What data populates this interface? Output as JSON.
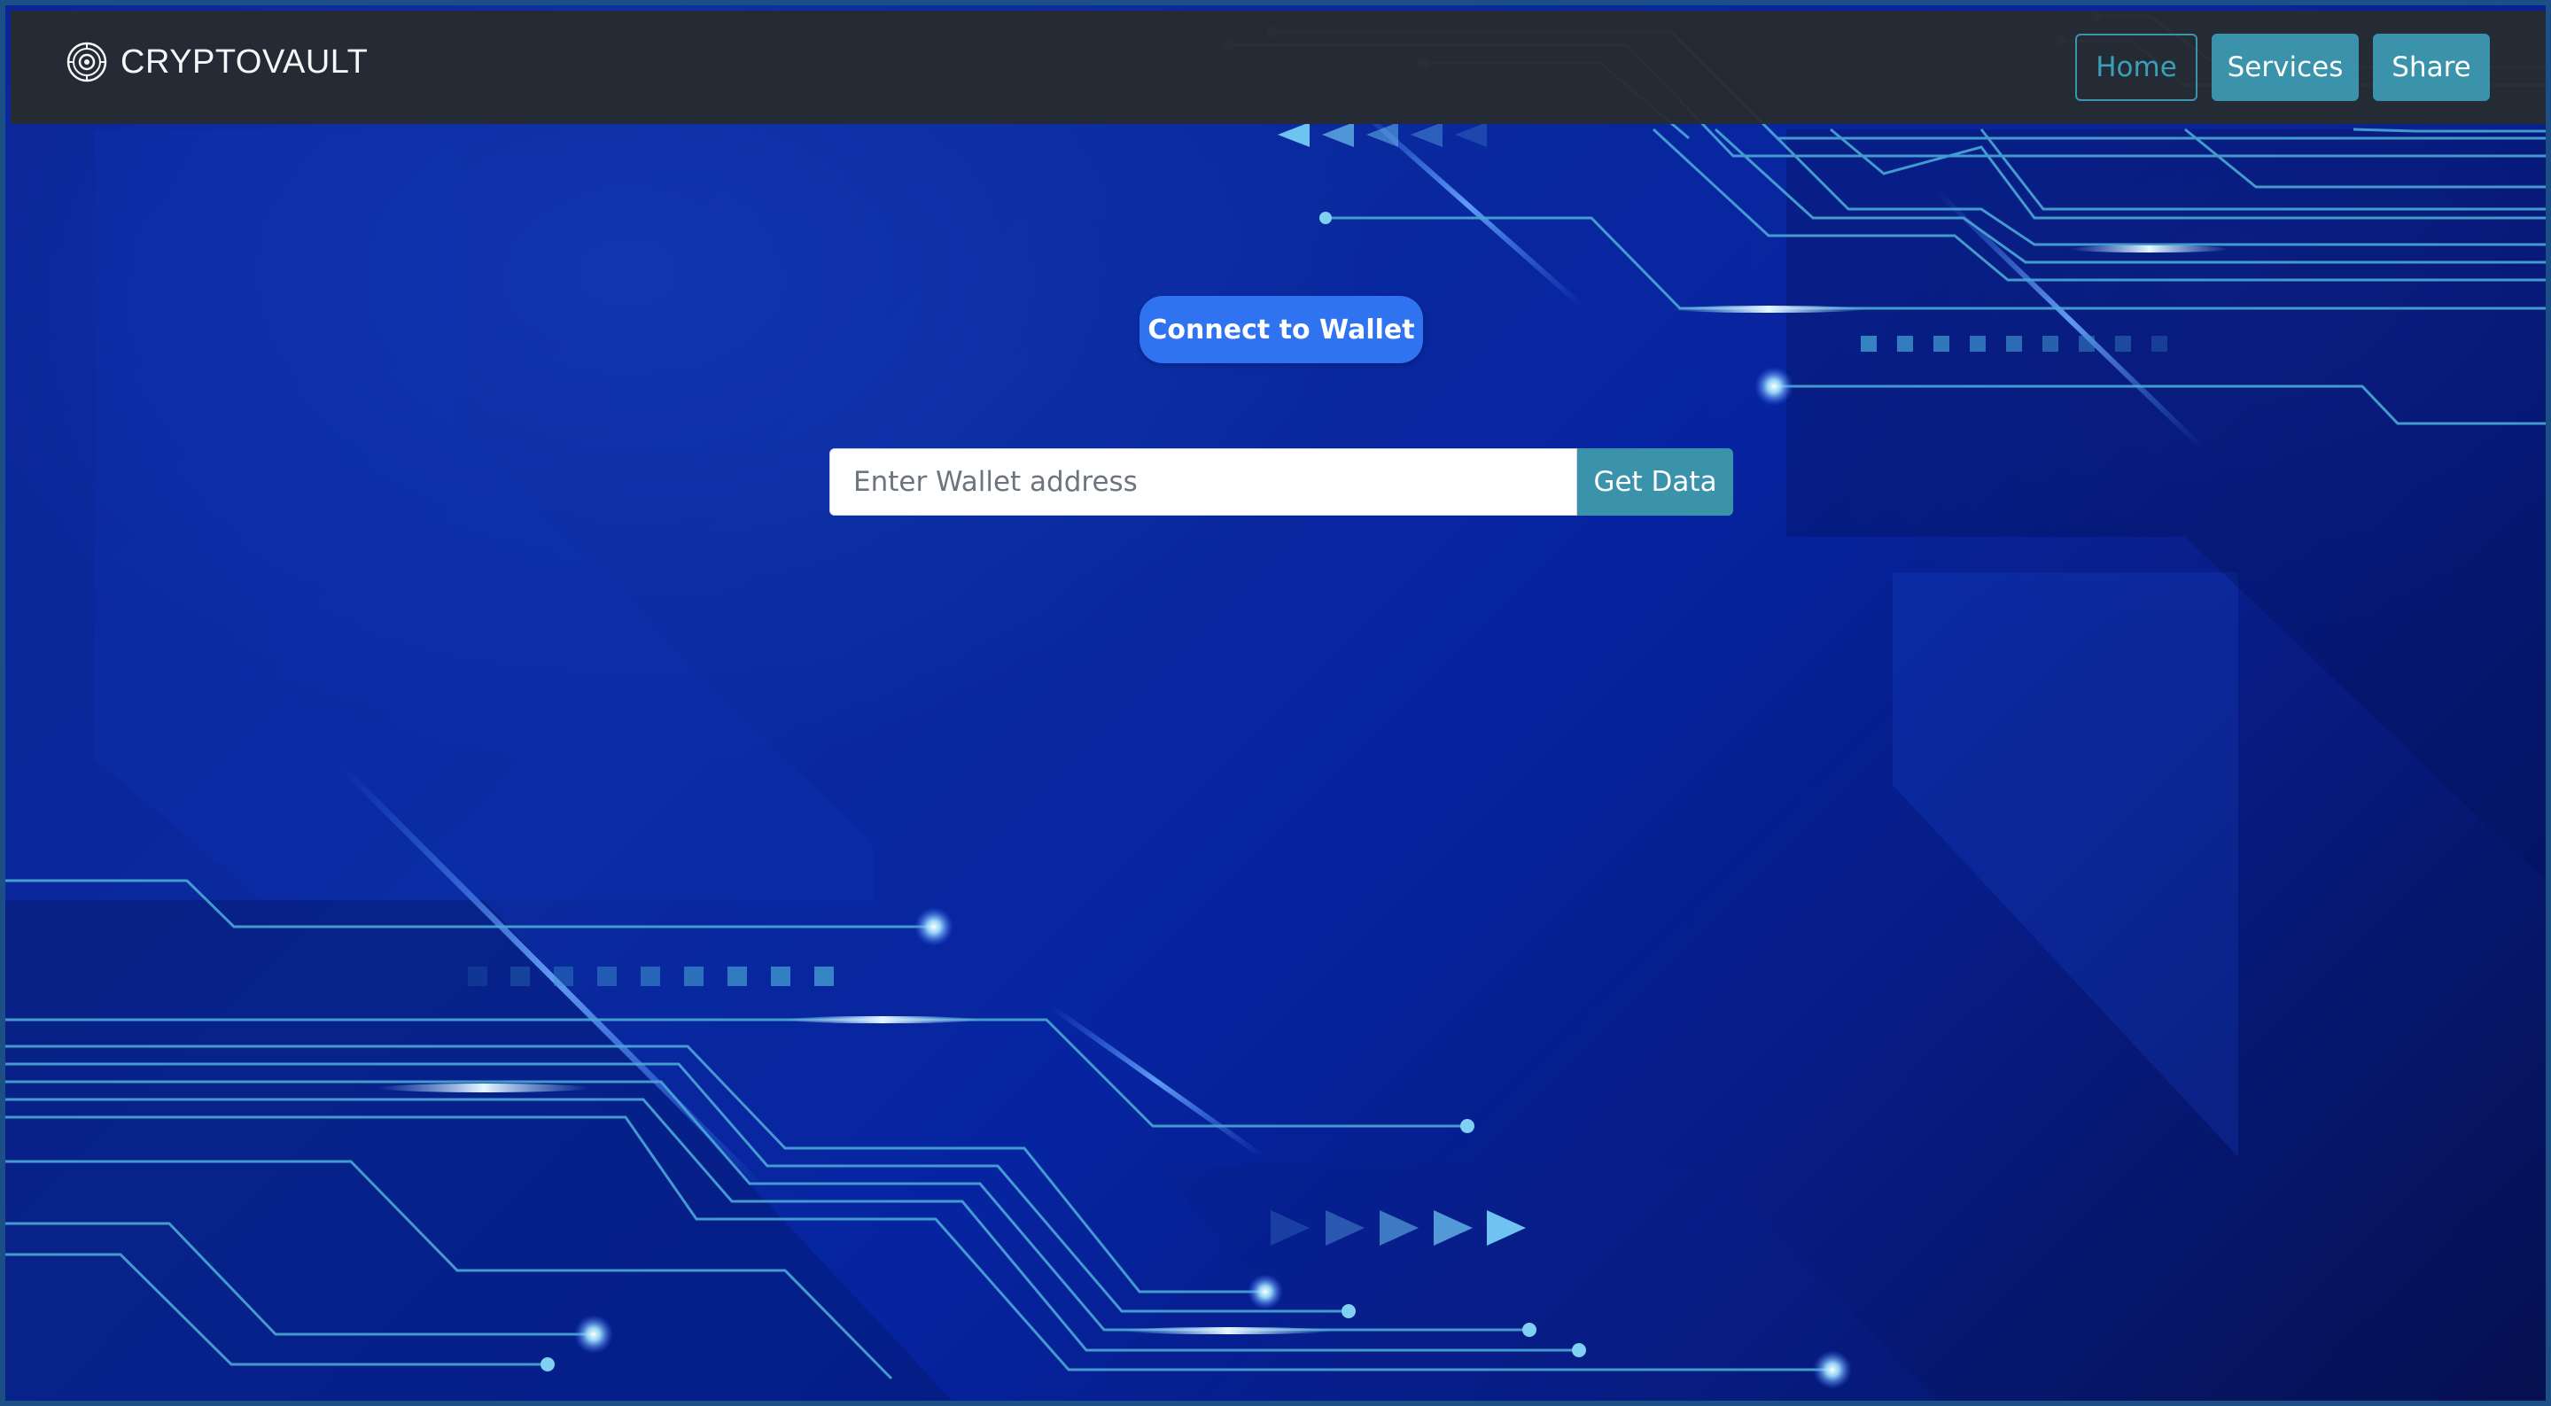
{
  "brand": {
    "name": "CRYPTOVAULT",
    "logo_icon": "vault-dial-icon"
  },
  "nav": {
    "items": [
      {
        "label": "Home",
        "style": "outline"
      },
      {
        "label": "Services",
        "style": "filled"
      },
      {
        "label": "Share",
        "style": "filled"
      }
    ]
  },
  "main": {
    "connect_button": "Connect to Wallet",
    "wallet_input": {
      "value": "",
      "placeholder": "Enter Wallet address"
    },
    "get_data_button": "Get Data"
  },
  "colors": {
    "navbar_bg": "#262b32",
    "accent_teal": "#3a93aa",
    "connect_blue": "#2f73f0",
    "background_blue": "#0a2a9e",
    "circuit_line": "#4fb3d9"
  }
}
